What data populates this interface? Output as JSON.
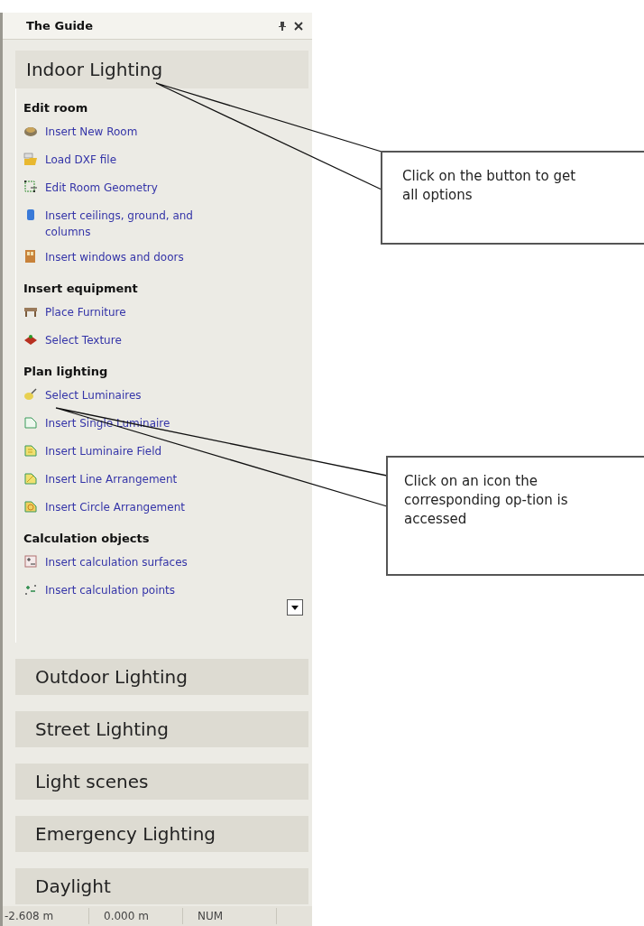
{
  "window": {
    "title": "The Guide"
  },
  "sections": [
    {
      "title": "Indoor Lighting",
      "expanded": true,
      "groups": [
        {
          "heading": "Edit room",
          "items": [
            {
              "label": "Insert New Room",
              "kind": "room"
            },
            {
              "label": "Load DXF file",
              "kind": "dxf"
            },
            {
              "label": "Edit Room Geometry",
              "kind": "geometry"
            },
            {
              "label": "Insert ceilings, ground, and columns",
              "kind": "ceiling"
            },
            {
              "label": "Insert windows and doors",
              "kind": "window"
            }
          ]
        },
        {
          "heading": "Insert equipment",
          "items": [
            {
              "label": "Place Furniture",
              "kind": "furniture"
            },
            {
              "label": "Select Texture",
              "kind": "texture"
            }
          ]
        },
        {
          "heading": "Plan lighting",
          "items": [
            {
              "label": "Select Luminaires",
              "kind": "luminaire"
            },
            {
              "label": "Insert Single Luminaire",
              "kind": "single"
            },
            {
              "label": "Insert Luminaire Field",
              "kind": "field"
            },
            {
              "label": "Insert Line Arrangement",
              "kind": "line"
            },
            {
              "label": "Insert Circle Arrangement",
              "kind": "circle"
            }
          ]
        },
        {
          "heading": "Calculation objects",
          "items": [
            {
              "label": "Insert calculation surfaces",
              "kind": "surface"
            },
            {
              "label": "Insert calculation points",
              "kind": "points"
            }
          ]
        }
      ]
    },
    {
      "title": "Outdoor Lighting",
      "expanded": false
    },
    {
      "title": "Street Lighting",
      "expanded": false
    },
    {
      "title": "Light scenes",
      "expanded": false
    },
    {
      "title": "Emergency Lighting",
      "expanded": false
    },
    {
      "title": "Daylight",
      "expanded": false
    }
  ],
  "status_bar": [
    "-2.608 m",
    "0.000 m",
    "NUM"
  ],
  "callouts": [
    {
      "text": "Click on the button to get all options"
    },
    {
      "text": "Click on an icon the corresponding op-tion is accessed"
    }
  ]
}
